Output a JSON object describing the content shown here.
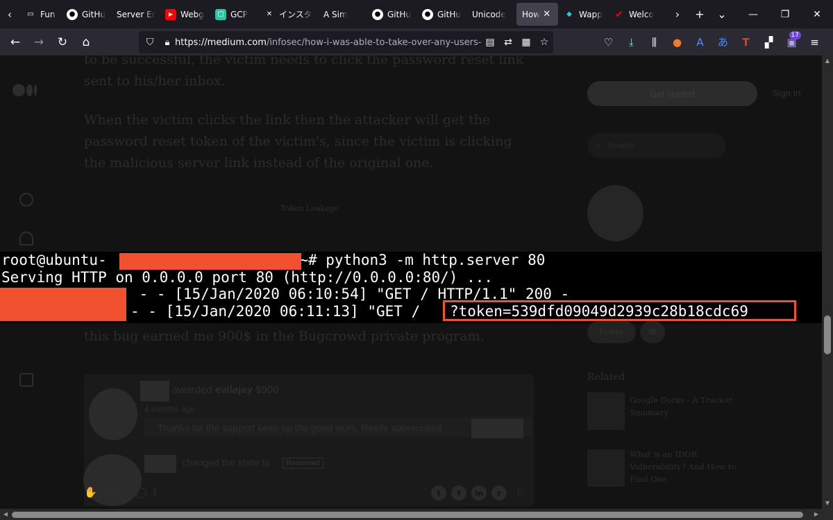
{
  "browser": {
    "tabs": [
      {
        "label": "Fun w",
        "favicon": "page-icon",
        "color": "#1c1b22"
      },
      {
        "label": "GitHu",
        "favicon": "github-icon",
        "color": "#ffffff"
      },
      {
        "label": "Server Erro",
        "favicon": "none",
        "color": "#1c1b22"
      },
      {
        "label": "Webg",
        "favicon": "youtube-icon",
        "color": "#ff0000"
      },
      {
        "label": "GCP",
        "favicon": "gcp-icon",
        "color": "#2ec4a6"
      },
      {
        "label": "インスタ",
        "favicon": "x-icon",
        "color": "#1c1b22"
      },
      {
        "label": "A Sim",
        "favicon": "none",
        "color": "#1c1b22"
      },
      {
        "label": "GitHu",
        "favicon": "github-icon",
        "color": "#ffffff"
      },
      {
        "label": "GitHu",
        "favicon": "github-icon",
        "color": "#ffffff"
      },
      {
        "label": "Unicode",
        "favicon": "none",
        "color": "#1c1b22"
      },
      {
        "label": "How",
        "favicon": "none",
        "color": "#1c1b22",
        "active": true
      },
      {
        "label": "Wapp",
        "favicon": "wappalyzer-icon",
        "color": "#4608ad"
      },
      {
        "label": "Welco",
        "favicon": "check-icon",
        "color": "#e8001c"
      }
    ],
    "address": {
      "url_host": "https://medium.com",
      "url_path": "/infosec/how-i-was-able-to-take-over-any-users-accou"
    },
    "extensions_badge": "17"
  },
  "article": {
    "para1": "to be successful, the victim needs to click the password reset link sent to his/her inbox.",
    "para2": "When the victim clicks the link then the attacker will get the password reset token of the victim's, since the victim is clicking the malicious server link instead of the original one.",
    "caption": "Token Leakage",
    "after_text": "this bug earned me 900$ in the Bugcrowd private program."
  },
  "terminal": {
    "line1_prompt_start": "root@ubuntu-",
    "line1_prompt_end": ":~# python3 -m http.server 80",
    "line2": "Serving HTTP on 0.0.0.0 port 80 (http://0.0.0.0:80/) ...",
    "line3": " - - [15/Jan/2020 06:10:54] \"GET / HTTP/1.1\" 200 -",
    "line4": "- - [15/Jan/2020 06:11:13] \"GET /",
    "token": "?token=539dfd09049d2939c28b18cdc69"
  },
  "comment": {
    "awarded_text": "awarded",
    "username": "evilajay",
    "amount": "$900",
    "time_ago": "4 months ago",
    "message": "Thanks for the support keep up the good work. Really appreciated",
    "state_text": "changed the state to",
    "state_badge": "Resolved"
  },
  "footer": {
    "claps": "344",
    "responses": "1"
  },
  "sidebar": {
    "get_started": "Get started",
    "sign_in": "Sign In",
    "search_placeholder": "Search",
    "follow": "Follow",
    "related_heading": "Related",
    "related": [
      {
        "title": "Google Dorks - A Tracker Summary"
      },
      {
        "title": "What is an IDOR Vulnerability? And How to Find One"
      }
    ]
  }
}
